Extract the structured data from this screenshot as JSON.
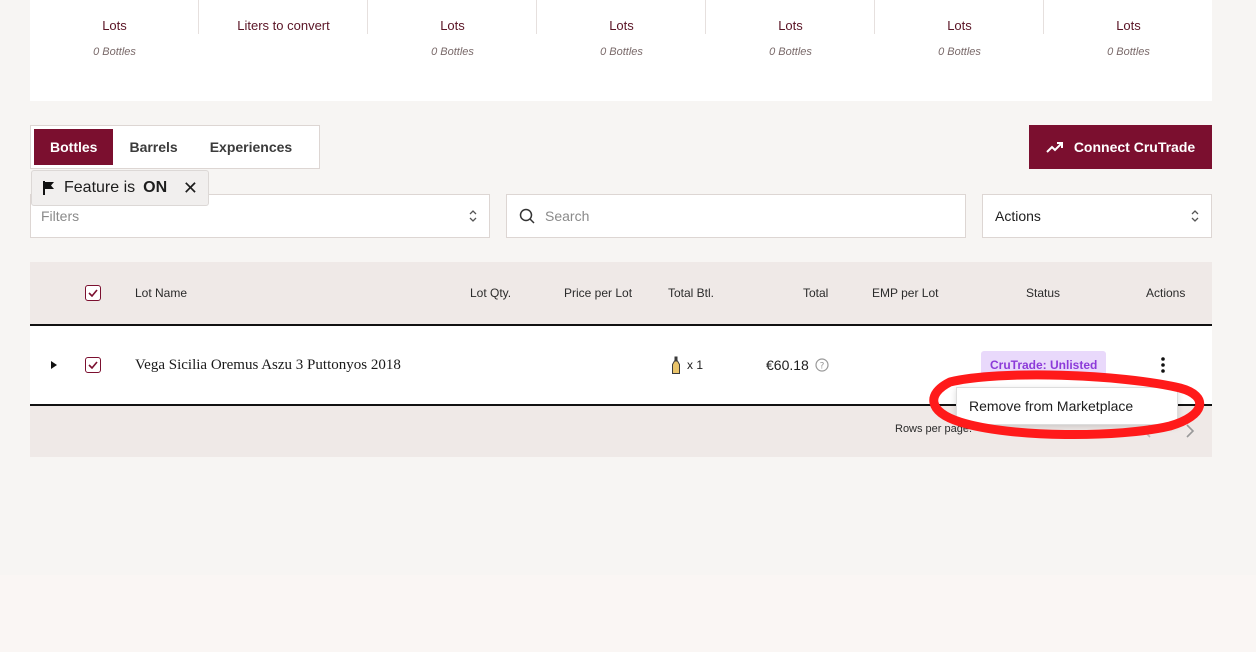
{
  "summary": {
    "stats": [
      {
        "label": "Lots",
        "sub": "0 Bottles"
      },
      {
        "label": "Liters to convert",
        "sub": ""
      },
      {
        "label": "Lots",
        "sub": "0 Bottles"
      },
      {
        "label": "Lots",
        "sub": "0 Bottles"
      },
      {
        "label": "Lots",
        "sub": "0 Bottles"
      },
      {
        "label": "Lots",
        "sub": "0 Bottles"
      },
      {
        "label": "Lots",
        "sub": "0 Bottles"
      }
    ]
  },
  "tabs": [
    {
      "label": "Bottles",
      "active": true
    },
    {
      "label": "Barrels",
      "active": false
    },
    {
      "label": "Experiences",
      "active": false
    }
  ],
  "connect_button": {
    "label": "Connect CruTrade",
    "icon": "trending-up-icon"
  },
  "feature_flag": {
    "prefix": "Feature is",
    "state": "ON"
  },
  "filters": {
    "placeholder": "Filters"
  },
  "search": {
    "placeholder": "Search"
  },
  "actions_select": {
    "value": "Actions"
  },
  "table": {
    "headers": {
      "lot_name": "Lot Name",
      "lot_qty": "Lot Qty.",
      "price_per_lot": "Price per Lot",
      "total_btl": "Total Btl.",
      "total": "Total",
      "emp_per_lot": "EMP per Lot",
      "status": "Status",
      "actions": "Actions"
    },
    "rows": [
      {
        "lot_name": "Vega Sicilia Oremus Aszu 3 Puttonyos 2018",
        "total_btl": "x 1",
        "total": "€60.18",
        "status": "CruTrade: Unlisted"
      }
    ]
  },
  "footer": {
    "rows_per_page_label": "Rows per page:"
  },
  "context_menu": {
    "item": "Remove from Marketplace"
  },
  "colors": {
    "brand": "#7b0f2f",
    "status_bg": "#e9d9fb",
    "status_text": "#8c3ad9",
    "annotation": "#ff1a1a"
  }
}
